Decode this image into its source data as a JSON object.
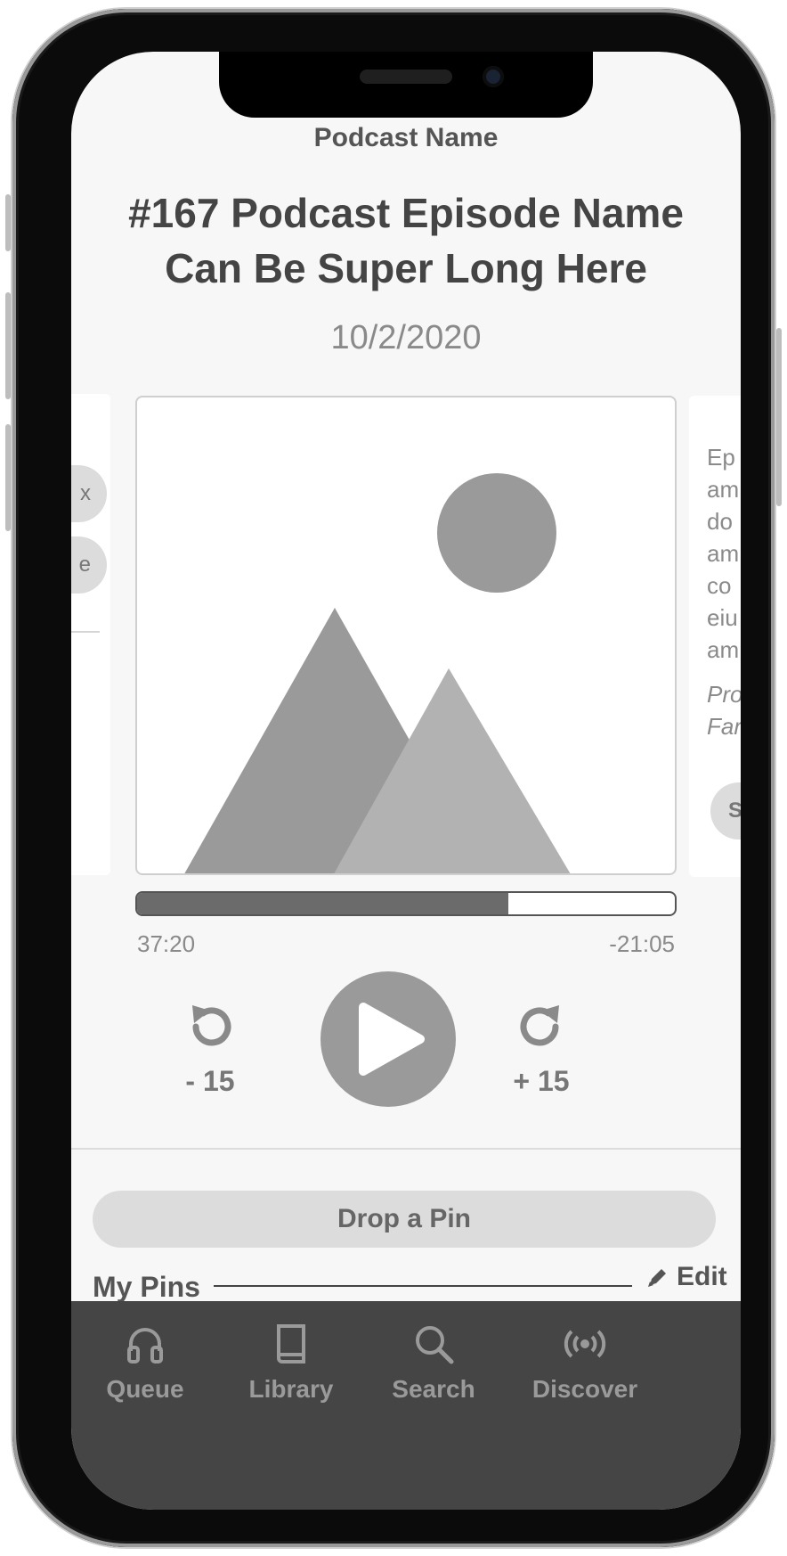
{
  "header": {
    "podcast_name": "Podcast Name",
    "episode_title": "#167 Podcast Episode Name Can Be Super Long Here",
    "date": "10/2/2020"
  },
  "carousel": {
    "left_chips": [
      "x",
      "e"
    ],
    "description_lines": [
      "Ep",
      "am",
      "do",
      "am",
      "co",
      "eiu",
      "am"
    ],
    "italic_lines": [
      "Pro",
      "Far"
    ],
    "right_chip": "S"
  },
  "player": {
    "elapsed": "37:20",
    "remaining": "-21:05",
    "progress": 0.69,
    "back_label": "- 15",
    "forward_label": "+ 15"
  },
  "pins": {
    "drop_pin_label": "Drop a Pin",
    "section_title": "My Pins",
    "edit_label": "Edit"
  },
  "tabs": [
    {
      "label": "Queue",
      "icon": "headphones-icon"
    },
    {
      "label": "Library",
      "icon": "book-icon"
    },
    {
      "label": "Search",
      "icon": "search-icon"
    },
    {
      "label": "Discover",
      "icon": "broadcast-icon"
    }
  ],
  "colors": {
    "background": "#f7f7f7",
    "tabbar": "#454545",
    "placeholder_dark": "#9a9a9a",
    "placeholder_light": "#b2b2b2"
  }
}
